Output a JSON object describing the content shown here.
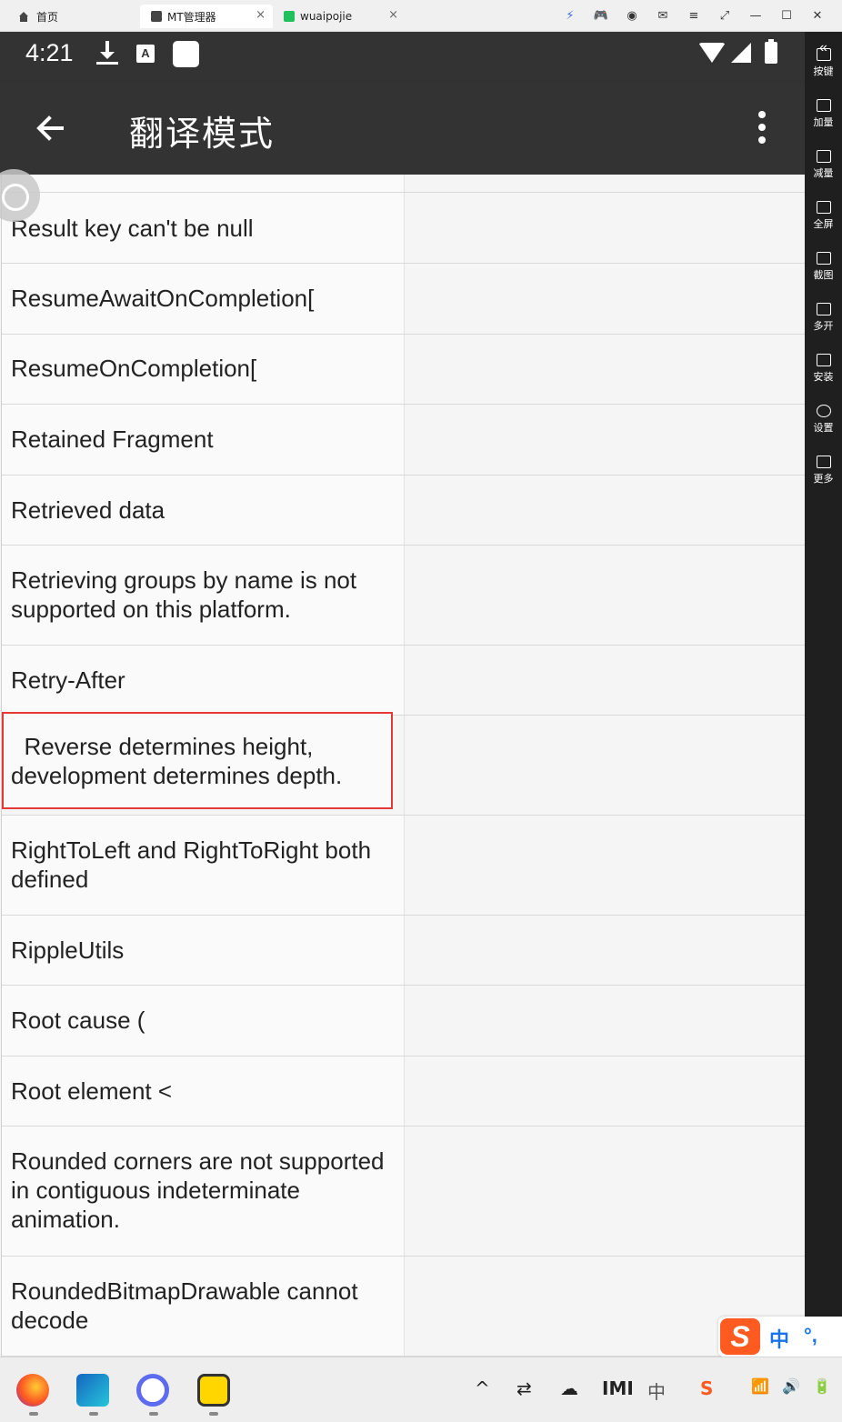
{
  "emulator": {
    "tabs": [
      {
        "label": "首页"
      },
      {
        "label": "MT管理器"
      },
      {
        "label": "wuaipojie"
      }
    ],
    "close_glyph": "×",
    "controls": [
      "⚡",
      "🎮",
      "◉",
      "✉",
      "≡",
      "⤢",
      "—",
      "☐",
      "✕"
    ],
    "sidebar_collapse": "«",
    "sidebar": [
      {
        "label": "按键",
        "icon": "keyboard-icon"
      },
      {
        "label": "加量",
        "icon": "volume-up-icon"
      },
      {
        "label": "减量",
        "icon": "volume-down-icon"
      },
      {
        "label": "全屏",
        "icon": "fullscreen-icon"
      },
      {
        "label": "截图",
        "icon": "scissors-icon"
      },
      {
        "label": "多开",
        "icon": "multi-instance-icon"
      },
      {
        "label": "安装",
        "icon": "apk-install-icon"
      },
      {
        "label": "设置",
        "icon": "settings-icon"
      },
      {
        "label": "更多",
        "icon": "more-icon"
      }
    ]
  },
  "status_bar": {
    "time": "4:21",
    "a_badge": "A"
  },
  "toolbar": {
    "title": "翻译模式"
  },
  "list": {
    "rows": [
      {
        "text": ""
      },
      {
        "text": "Result key can't be null"
      },
      {
        "text": "ResumeAwaitOnCompletion["
      },
      {
        "text": "ResumeOnCompletion["
      },
      {
        "text": "Retained Fragment"
      },
      {
        "text": "Retrieved data"
      },
      {
        "text": "Retrieving groups by name is not supported on this platform."
      },
      {
        "text": "Retry-After"
      },
      {
        "text": "  Reverse determines height, development determines depth.",
        "highlighted": true
      },
      {
        "text": "RightToLeft and RightToRight both defined"
      },
      {
        "text": "RippleUtils"
      },
      {
        "text": "Root cause ("
      },
      {
        "text": "Root element <"
      },
      {
        "text": "Rounded corners are not supported in contiguous indeterminate animation."
      },
      {
        "text": "RoundedBitmapDrawable cannot decode"
      }
    ]
  },
  "ime": {
    "logo": "S",
    "mode": "中",
    "punct": "°,"
  },
  "taskbar": {
    "tray": [
      "^",
      "⇄",
      "☁",
      "IMI",
      "中",
      "S",
      "📶",
      "🔊",
      "🔋"
    ]
  },
  "colors": {
    "appbar": "#333333",
    "highlight": "#e53935",
    "ime": "#ff5a1f"
  }
}
